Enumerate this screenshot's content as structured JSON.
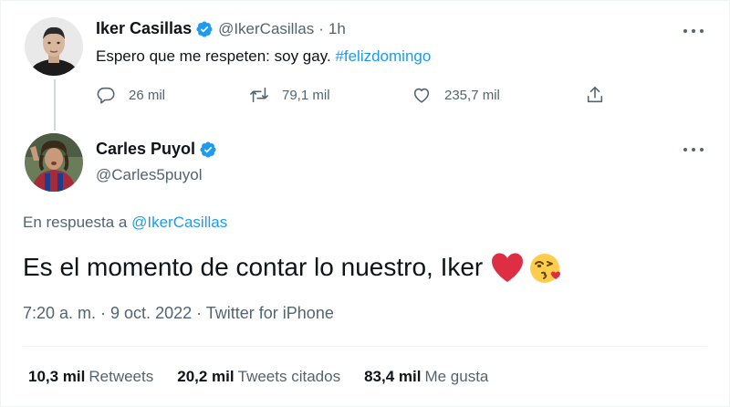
{
  "original_tweet": {
    "display_name": "Iker Casillas",
    "handle": "@IkerCasillas",
    "separator": "·",
    "time_ago": "1h",
    "text": "Espero que me respeten: soy gay.",
    "hashtag": "#felizdomingo",
    "actions": {
      "replies": "26 mil",
      "retweets": "79,1 mil",
      "likes": "235,7 mil"
    }
  },
  "reply_tweet": {
    "display_name": "Carles Puyol",
    "handle": "@Carles5puyol",
    "reply_prefix": "En respuesta a",
    "reply_mention": "@IkerCasillas",
    "text": "Es el momento de contar lo nuestro, Iker",
    "timestamp": "7:20 a. m. · 9 oct. 2022 · Twitter for iPhone",
    "stats": [
      {
        "value": "10,3 mil",
        "label": "Retweets"
      },
      {
        "value": "20,2 mil",
        "label": "Tweets citados"
      },
      {
        "value": "83,4 mil",
        "label": "Me gusta"
      }
    ]
  },
  "colors": {
    "accent": "#1d9bf0",
    "secondary_text": "#536471",
    "primary_text": "#0f1419",
    "heart": "#e0245e"
  },
  "icons": [
    "verified-badge-icon",
    "more-icon",
    "reply-icon",
    "retweet-icon",
    "like-icon",
    "share-icon",
    "heart-emoji-icon",
    "kiss-emoji-icon"
  ]
}
